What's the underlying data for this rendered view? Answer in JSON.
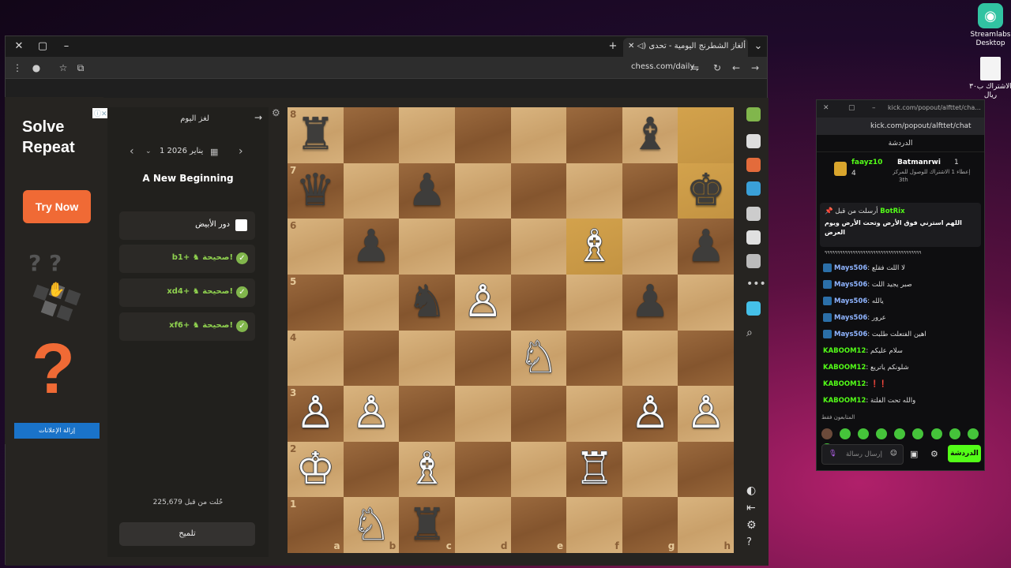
{
  "desktop": {
    "streamlabs_label": "Streamlabs Desktop",
    "file_label": "الاشتراك ب٣٠ ريال"
  },
  "browser": {
    "tab_title": "ألغاز الشطرنج اليومية - تحدى",
    "url": "chess.com/daily"
  },
  "ad": {
    "info": "ⓘ✕",
    "title_line1": "Solve",
    "title_line2": "Repeat",
    "button": "Try Now",
    "question": "?",
    "remove_ads": "إزالة الإعلانات"
  },
  "panel": {
    "title": "لغز اليوم",
    "back": "→",
    "date": "1 يناير 2026",
    "puzzle_name": "A New Beginning",
    "turn": "دور الأبيض",
    "moves": [
      {
        "text": "b1+ ♞ صحيحة!"
      },
      {
        "text": "xd4+ ♞ صحيحة!"
      },
      {
        "text": "xf6+ ♞ صحيحة!"
      }
    ],
    "solved_count": "225,679 حُلت من قبل",
    "hint": "تلميح"
  },
  "board": {
    "ranks": [
      "8",
      "7",
      "6",
      "5",
      "4",
      "3",
      "2",
      "1"
    ],
    "files": [
      "a",
      "b",
      "c",
      "d",
      "e",
      "f",
      "g",
      "h"
    ],
    "squares": [
      [
        "♜",
        "",
        "",
        "",
        "",
        "",
        "♝",
        ""
      ],
      [
        "♛",
        "",
        "♟",
        "",
        "",
        "",
        "",
        "♚"
      ],
      [
        "",
        "♟",
        "",
        "",
        "",
        "♗",
        "",
        "♟"
      ],
      [
        "",
        "",
        "♞",
        "♙",
        "",
        "",
        "♟",
        ""
      ],
      [
        "",
        "",
        "",
        "",
        "♘",
        "",
        "",
        ""
      ],
      [
        "♙",
        "♙",
        "",
        "",
        "",
        "",
        "♙",
        "♙"
      ],
      [
        "♔",
        "",
        "♗",
        "",
        "",
        "♖",
        "",
        ""
      ],
      [
        "",
        "♘",
        "♜",
        "",
        "",
        "",
        "",
        ""
      ]
    ],
    "colors": [
      [
        "b",
        "",
        "",
        "",
        "",
        "",
        "b",
        ""
      ],
      [
        "b",
        "",
        "b",
        "",
        "",
        "",
        "",
        "b"
      ],
      [
        "",
        "b",
        "",
        "",
        "",
        "w",
        "",
        "b"
      ],
      [
        "",
        "",
        "b",
        "w",
        "",
        "",
        "b",
        ""
      ],
      [
        "",
        "",
        "",
        "",
        "w",
        "",
        "",
        ""
      ],
      [
        "w",
        "w",
        "",
        "",
        "",
        "",
        "w",
        "w"
      ],
      [
        "w",
        "",
        "w",
        "",
        "",
        "w",
        "",
        ""
      ],
      [
        "",
        "w",
        "b",
        "",
        "",
        "",
        "",
        ""
      ]
    ],
    "highlights": [
      "h8",
      "h7",
      "f6"
    ]
  },
  "chat": {
    "window_title": "kick.com/popout/alfttet/cha...",
    "url": "kick.com/popout/alfttet/chat",
    "label": "الدردشة",
    "leader1_name": "Batmanrwi",
    "leader1_count": "1",
    "leader1_note": "إعطاء 1 الاشتراك للوصول للمركز",
    "leader1_rank": "3th",
    "leader2_name": "faayz10",
    "leader2_count": "4",
    "pinned_by": "BotRix",
    "pinned_prefix": "أرسلت من قبل",
    "pinned_text": "اللهم استرني فوق الأرض وتحت الأرض ويوم العرض",
    "stray": "٩٩٩٩٩٩٩٩٩٩٩٩٩٩٩٩٩٩٩٩٩٩٩٩٩٩٩٩٩٩٩٩٩٩٩٩٩٩",
    "messages": [
      {
        "user": "Mays506",
        "text": "لا اللت فقلع",
        "color": "blue"
      },
      {
        "user": "Mays506",
        "text": "صبر يجيد اللت",
        "color": "blue"
      },
      {
        "user": "Mays506",
        "text": "يالله",
        "color": "blue"
      },
      {
        "user": "Mays506",
        "text": "عرور",
        "color": "blue"
      },
      {
        "user": "Mays506",
        "text": "اهين الفتعلت طلبت",
        "color": "blue"
      },
      {
        "user": "KABOOM12",
        "text": "سلام عليكم",
        "color": "green"
      },
      {
        "user": "KABOOM12",
        "text": "شلونكم ياتريع",
        "color": "green"
      },
      {
        "user": "KABOOM12",
        "text": "❗❗",
        "color": "green"
      },
      {
        "user": "KABOOM12",
        "text": "والله تحت الفلتة",
        "color": "green"
      }
    ],
    "followers_only": "المتابعون فقط",
    "input_placeholder": "إرسال رسالة",
    "send": "الدردشة"
  }
}
